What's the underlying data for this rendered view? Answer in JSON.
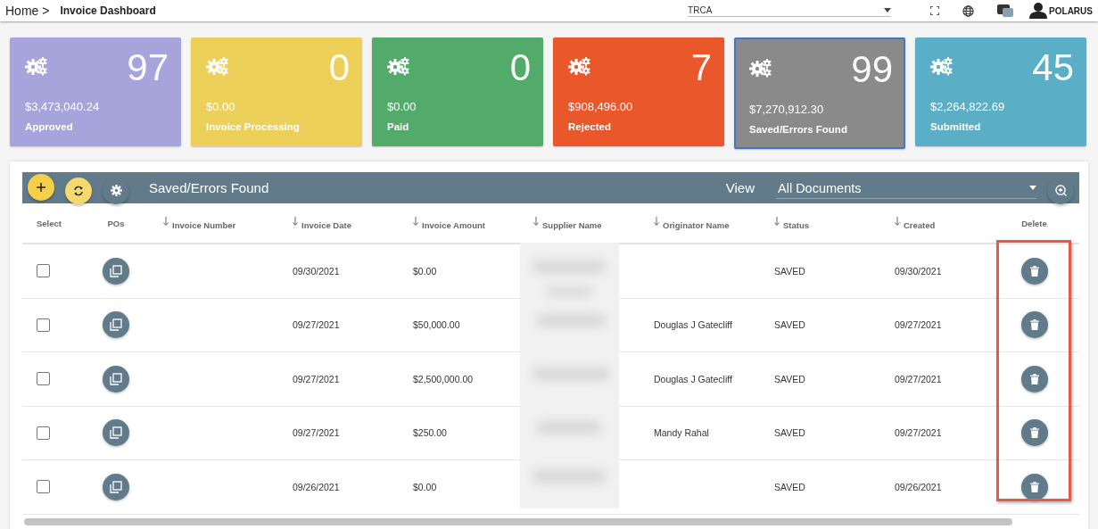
{
  "header": {
    "breadcrumb": "Home >",
    "title": "Invoice Dashboard",
    "company_select": "TRCA",
    "user": "POLARUS"
  },
  "cards": [
    {
      "count": "97",
      "amount": "$3,473,040.24",
      "label": "Approved",
      "color": "#a7a4dc",
      "selected": false
    },
    {
      "count": "0",
      "amount": "$0.00",
      "label": "Invoice Processing",
      "color": "#edd05a",
      "selected": false
    },
    {
      "count": "0",
      "amount": "$0.00",
      "label": "Paid",
      "color": "#52ab6b",
      "selected": false
    },
    {
      "count": "7",
      "amount": "$908,496.00",
      "label": "Rejected",
      "color": "#e9572b",
      "selected": false
    },
    {
      "count": "99",
      "amount": "$7,270,912.30",
      "label": "Saved/Errors Found",
      "color": "#8a8a8a",
      "selected": true
    },
    {
      "count": "45",
      "amount": "$2,264,822.69",
      "label": "Submitted",
      "color": "#5aaec5",
      "selected": false
    }
  ],
  "toolbar": {
    "title": "Saved/Errors Found",
    "view_label": "View",
    "view_select": "All Documents"
  },
  "table": {
    "columns": [
      {
        "label": "Select",
        "sortable": false
      },
      {
        "label": "POs",
        "sortable": false
      },
      {
        "label": "Invoice Number",
        "sortable": true
      },
      {
        "label": "Invoice Date",
        "sortable": true
      },
      {
        "label": "Invoice Amount",
        "sortable": true
      },
      {
        "label": "Supplier Name",
        "sortable": true
      },
      {
        "label": "Originator Name",
        "sortable": true
      },
      {
        "label": "Status",
        "sortable": true
      },
      {
        "label": "Created",
        "sortable": true
      },
      {
        "label": "Delete",
        "sortable": false
      }
    ],
    "rows": [
      {
        "checked": false,
        "invoice_date": "09/30/2021",
        "invoice_amount": "$0.00",
        "originator": "",
        "status": "SAVED",
        "created": "09/30/2021"
      },
      {
        "checked": false,
        "invoice_date": "09/27/2021",
        "invoice_amount": "$50,000.00",
        "originator": "Douglas J Gatecliff",
        "status": "SAVED",
        "created": "09/27/2021"
      },
      {
        "checked": false,
        "invoice_date": "09/27/2021",
        "invoice_amount": "$2,500,000.00",
        "originator": "Douglas J Gatecliff",
        "status": "SAVED",
        "created": "09/27/2021"
      },
      {
        "checked": false,
        "invoice_date": "09/27/2021",
        "invoice_amount": "$250.00",
        "originator": "Mandy Rahal",
        "status": "SAVED",
        "created": "09/27/2021"
      },
      {
        "checked": false,
        "invoice_date": "09/26/2021",
        "invoice_amount": "$0.00",
        "originator": "",
        "status": "SAVED",
        "created": "09/26/2021"
      }
    ]
  }
}
